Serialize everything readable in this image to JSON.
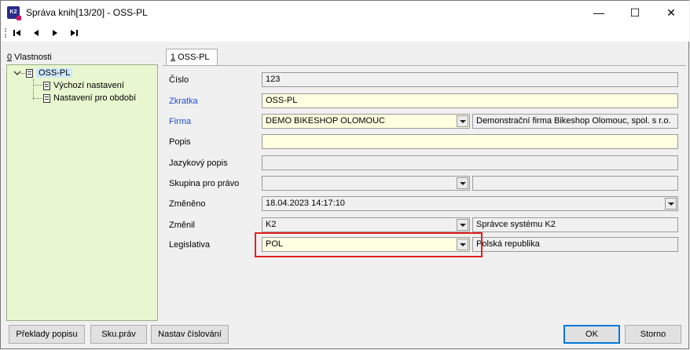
{
  "window": {
    "title": "Správa knih[13/20] - OSS-PL",
    "icon_text": "K2",
    "minimize": "—",
    "maximize": "☐",
    "close": "✕"
  },
  "toolbar": {
    "items": [
      "first-record-icon",
      "prev-record-icon",
      "next-record-icon",
      "last-record-icon"
    ]
  },
  "left": {
    "label_key": "0",
    "label_text": " Vlastnosti",
    "tree": [
      {
        "label": "OSS-PL",
        "level": 0,
        "selected": true
      },
      {
        "label": "Výchozí nastavení",
        "level": 1
      },
      {
        "label": "Nastavení pro období",
        "level": 1
      }
    ]
  },
  "tab": {
    "key": "1",
    "label": " OSS-PL"
  },
  "form": {
    "cislo": {
      "label": "Číslo",
      "value": "123"
    },
    "zkratka": {
      "label": "Zkratka",
      "value": "OSS-PL"
    },
    "firma": {
      "label": "Firma",
      "value": "DEMO BIKESHOP OLOMOUC",
      "desc": "Demonstrační firma Bikeshop Olomouc, spol. s r.o."
    },
    "popis": {
      "label": "Popis",
      "value": ""
    },
    "jazykovy_popis": {
      "label": "Jazykový popis",
      "value": ""
    },
    "skupina_pro_pravo": {
      "label": "Skupina pro právo",
      "value": "",
      "desc": ""
    },
    "zmeneno": {
      "label": "Změněno",
      "value": "18.04.2023 14:17:10"
    },
    "zmenil": {
      "label": "Změnil",
      "value": "K2",
      "desc": "Správce systému K2"
    },
    "legislativa": {
      "label": "Legislativa",
      "value": "POL",
      "desc": "Polská republika"
    }
  },
  "buttons": {
    "preklady_popisu": "Překlady popisu",
    "sku_prav": "Sku.práv",
    "nastav_cislovani": "Nastav číslování",
    "ok": "OK",
    "storno": "Storno"
  },
  "colors": {
    "tree_bg": "#e8f7cf",
    "required_bg": "#ffffe1",
    "highlight": "#e32020",
    "required_label": "#1f4fd1"
  }
}
